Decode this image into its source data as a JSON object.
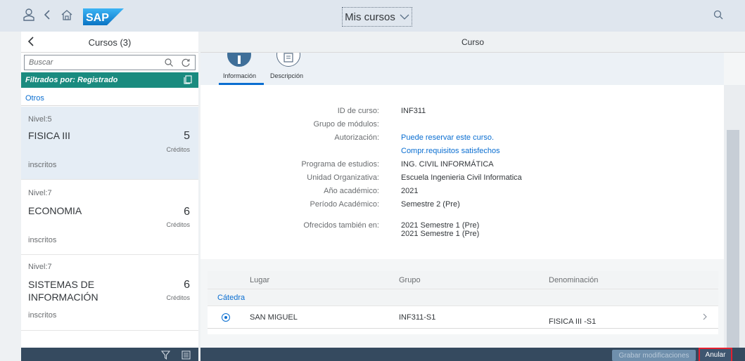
{
  "shell": {
    "title": "Mis cursos"
  },
  "left_panel": {
    "title": "Cursos (3)",
    "search_placeholder": "Buscar",
    "filter_text": "Filtrados por: Registrado",
    "group_label": "Otros",
    "items": [
      {
        "level": "Nivel:5",
        "name": "FISICA III",
        "credits": "5",
        "credits_unit": "Créditos",
        "status": "inscritos",
        "selected": true
      },
      {
        "level": "Nivel:7",
        "name": "ECONOMIA",
        "credits": "6",
        "credits_unit": "Créditos",
        "status": "inscritos",
        "selected": false
      },
      {
        "level": "Nivel:7",
        "name": "SISTEMAS DE INFORMACIÓN",
        "name_line1": "SISTEMAS DE",
        "name_line2": "INFORMACIÓN",
        "credits": "6",
        "credits_unit": "Créditos",
        "status": "inscritos",
        "selected": false
      }
    ]
  },
  "detail": {
    "title": "Curso",
    "tabs": [
      {
        "label": "Información",
        "active": true
      },
      {
        "label": "Descripción",
        "active": false
      }
    ],
    "fields": [
      {
        "label": "ID de curso:",
        "value": "INF311",
        "link": false
      },
      {
        "label": "Grupo de módulos:",
        "value": "",
        "link": false
      },
      {
        "label": "Autorización:",
        "value": "Puede reservar este curso.",
        "link": true
      },
      {
        "label": "",
        "value": "Compr.requisitos satisfechos",
        "link": true
      },
      {
        "label": "Programa de estudios:",
        "value": "ING. CIVIL INFORMÁTICA",
        "link": false
      },
      {
        "label": "Unidad Organizativa:",
        "value": "Escuela Ingenieria Civil Informatica",
        "link": false
      },
      {
        "label": "Año académico:",
        "value": "2021",
        "link": false
      },
      {
        "label": "Período Académico:",
        "value": "Semestre 2 (Pre)",
        "link": false
      },
      {
        "label": "Ofrecidos también en:",
        "value": "2021 Semestre 1 (Pre)",
        "link": false
      },
      {
        "label": "",
        "value": "2021 Semestre 1 (Pre)",
        "link": false
      }
    ],
    "table": {
      "columns": [
        "Lugar",
        "Grupo",
        "Denominación"
      ],
      "group": "Cátedra",
      "rows": [
        {
          "lugar": "SAN MIGUEL",
          "grupo": "INF311-S1",
          "denominacion": "FISICA III -S1",
          "selected": true
        }
      ]
    },
    "footer": {
      "save_label": "Grabar modificaciones",
      "cancel_label": "Anular"
    }
  },
  "colors": {
    "accent": "#0a6ed1",
    "filter_bar": "#1a8b7f",
    "footer": "#354a5f",
    "highlight_box": "#e5202f"
  }
}
